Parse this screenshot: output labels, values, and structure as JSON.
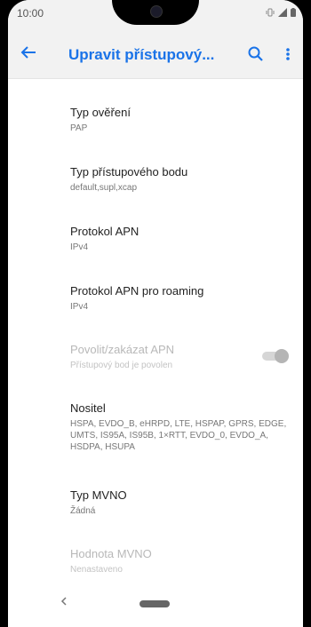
{
  "status_bar": {
    "time": "10:00"
  },
  "app_bar": {
    "title": "Upravit přístupový..."
  },
  "settings": [
    {
      "title": "Typ ověření",
      "subtitle": "PAP"
    },
    {
      "title": "Typ přístupového bodu",
      "subtitle": "default,supl,xcap"
    },
    {
      "title": "Protokol APN",
      "subtitle": "IPv4"
    },
    {
      "title": "Protokol APN pro roaming",
      "subtitle": "IPv4"
    },
    {
      "title": "Povolit/zakázat APN",
      "subtitle": "Přístupový bod je povolen",
      "disabled": true,
      "toggle_on": true
    },
    {
      "title": "Nositel",
      "subtitle": "HSPA, EVDO_B, eHRPD, LTE, HSPAP, GPRS, EDGE, UMTS, IS95A, IS95B, 1×RTT, EVDO_0, EVDO_A, HSDPA, HSUPA"
    },
    {
      "title": "Typ MVNO",
      "subtitle": "Žádná"
    },
    {
      "title": "Hodnota MVNO",
      "subtitle": "Nenastaveno",
      "disabled": true
    }
  ],
  "icons": {
    "back": "arrow-left-icon",
    "search": "search-icon",
    "more": "more-vert-icon",
    "nav_back": "chevron-left-icon"
  },
  "colors": {
    "accent": "#1a73e8",
    "appbar_bg": "#f2f2f2"
  }
}
